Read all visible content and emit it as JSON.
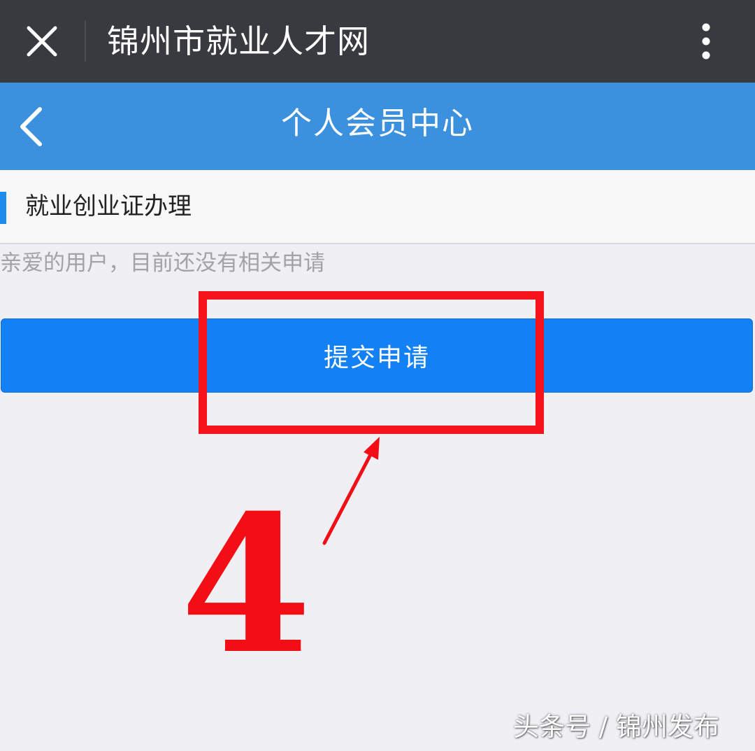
{
  "topbar": {
    "title": "锦州市就业人才网",
    "close_icon": "close-icon",
    "more_icon": "more-vertical-icon",
    "background": "#393a3f"
  },
  "navbar": {
    "title": "个人会员中心",
    "back_icon": "chevron-left-icon",
    "background": "#3b91dd"
  },
  "section": {
    "title": "就业创业证办理",
    "accent_color": "#1f8ded"
  },
  "content": {
    "empty_message": "亲爱的用户，目前还没有相关申请",
    "submit_label": "提交申请",
    "button_color": "#1380f4"
  },
  "annotation": {
    "step_number": "4",
    "highlight_color": "#f5141b"
  },
  "watermark": {
    "text": "头条号 / 锦州发布"
  }
}
